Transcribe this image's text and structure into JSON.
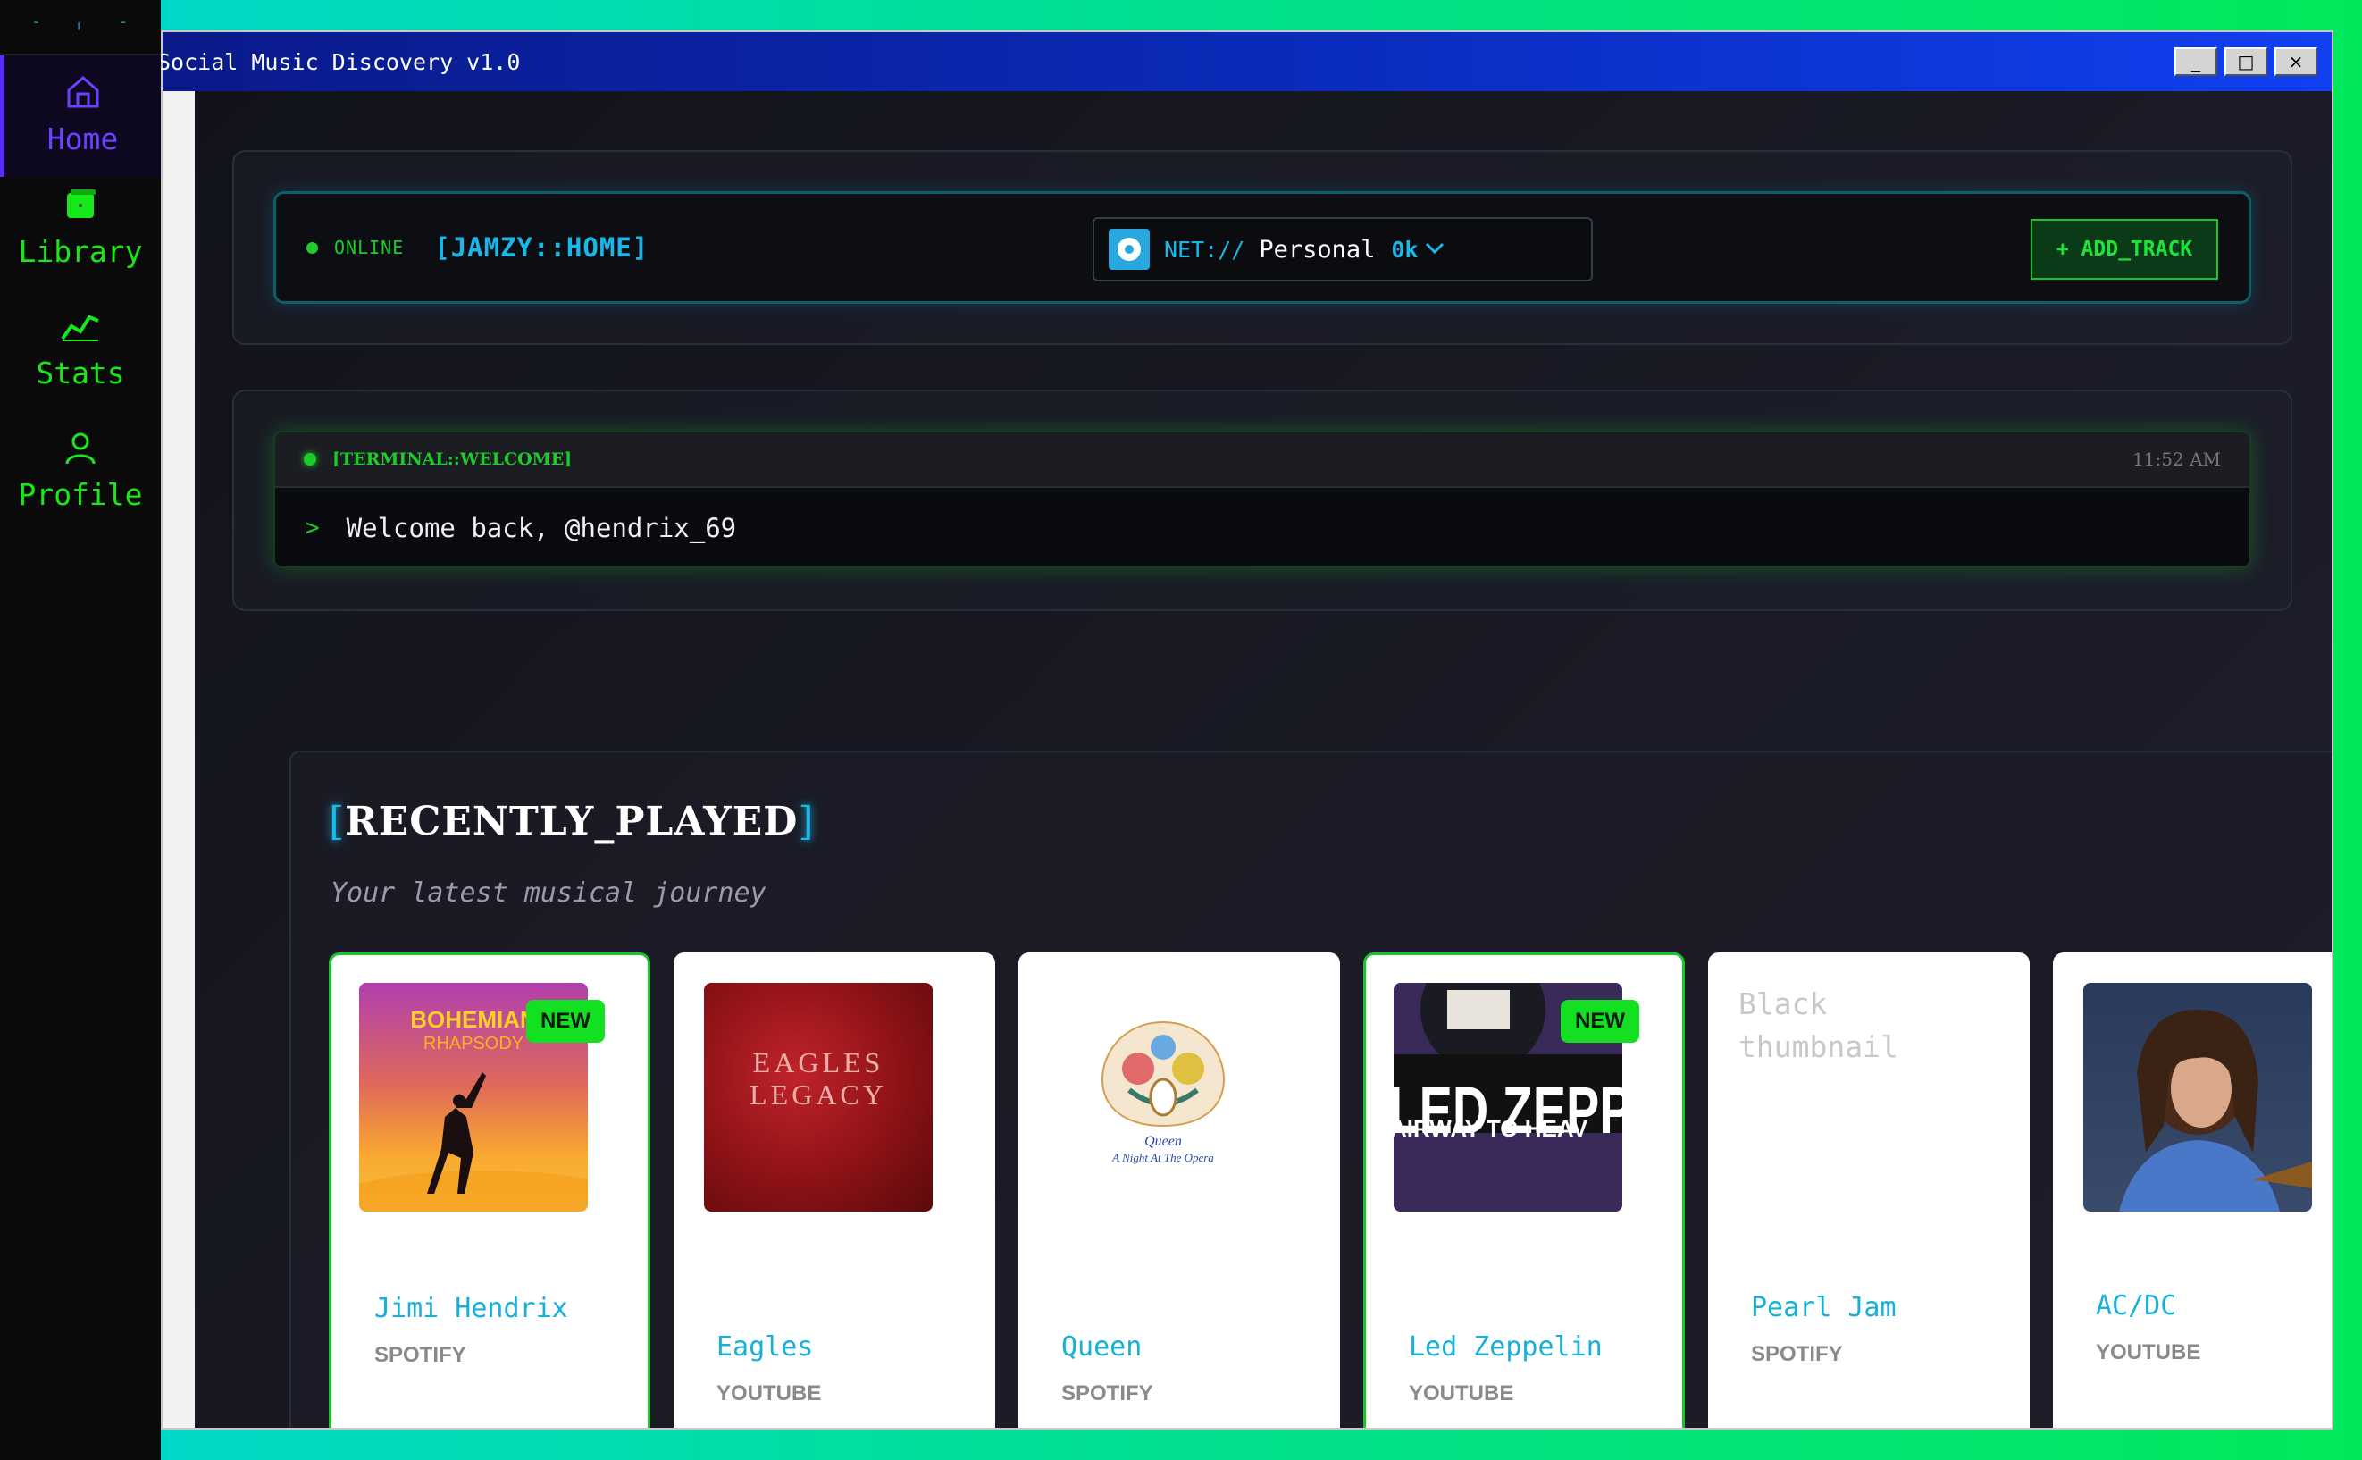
{
  "sidebar": {
    "items": [
      {
        "label": "Home",
        "icon": "home-icon",
        "active": true
      },
      {
        "label": "Library",
        "icon": "library-icon"
      },
      {
        "label": "Stats",
        "icon": "stats-icon"
      },
      {
        "label": "Profile",
        "icon": "profile-icon"
      }
    ]
  },
  "window": {
    "title": "Social Music Discovery v1.0",
    "buttons": {
      "minimize": "_",
      "maximize": "□",
      "close": "×"
    }
  },
  "header": {
    "status": "ONLINE",
    "title": "[JAMZY::HOME]",
    "network": {
      "prefix": "NET://",
      "name": "Personal",
      "count": "0k"
    },
    "add_track_label": "+ ADD_TRACK"
  },
  "terminal": {
    "title": "[TERMINAL::WELCOME]",
    "time": "11:52 AM",
    "prompt": ">",
    "message": "Welcome back, @hendrix_69"
  },
  "recent": {
    "title_open": "[",
    "title": "RECENTLY_PLAYED",
    "title_close": "]",
    "subtitle": "Your latest musical journey",
    "tracks": [
      {
        "artist": "Jimi Hendrix",
        "source": "SPOTIFY",
        "badge": "NEW",
        "art_text": [
          "BOHEMIAN",
          "RHAPSODY"
        ]
      },
      {
        "artist": "Eagles",
        "source": "YOUTUBE",
        "art_text": [
          "EAGLES",
          "LEGACY"
        ]
      },
      {
        "artist": "Queen",
        "source": "SPOTIFY",
        "art_text": [
          "Queen",
          "A Night At The Opera"
        ]
      },
      {
        "artist": "Led Zeppelin",
        "source": "YOUTUBE",
        "badge": "NEW",
        "art_text": [
          "LED ZEPPELIN",
          "AIRWAY TO HEAV"
        ]
      },
      {
        "artist": "Pearl Jam",
        "source": "SPOTIFY",
        "alt_text": "Black thumbnail"
      },
      {
        "artist": "AC/DC",
        "source": "YOUTUBE"
      }
    ]
  },
  "colors": {
    "accent_green": "#16c72c",
    "accent_cyan": "#19b8e8",
    "accent_purple": "#6644ff"
  }
}
